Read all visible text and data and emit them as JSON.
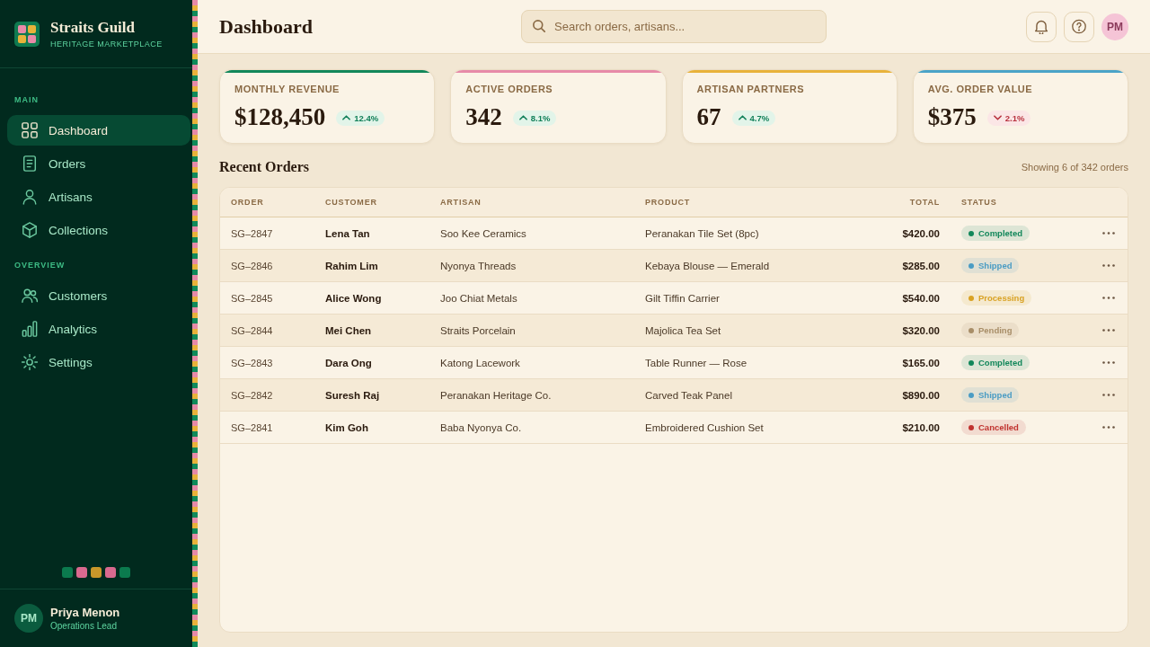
{
  "sidebar": {
    "brand": {
      "name": "Straits Guild",
      "tagline": "HERITAGE MARKETPLACE"
    },
    "sections": [
      {
        "label": "MAIN",
        "items": [
          {
            "label": "Dashboard",
            "selected": true
          },
          {
            "label": "Orders",
            "selected": false
          },
          {
            "label": "Artisans",
            "selected": false
          },
          {
            "label": "Collections",
            "selected": false
          }
        ]
      },
      {
        "label": "OVERVIEW",
        "items": [
          {
            "label": "Customers",
            "selected": false
          },
          {
            "label": "Analytics",
            "selected": false
          },
          {
            "label": "Settings",
            "selected": false
          }
        ]
      }
    ],
    "swatches": [
      {
        "color": "#0b7a4e"
      },
      {
        "color": "#d9698f"
      },
      {
        "color": "#c9972a"
      },
      {
        "color": "#d9698f"
      },
      {
        "color": "#0b7a4e"
      }
    ],
    "user": {
      "initials": "PM",
      "name": "Priya Menon",
      "role": "Operations Lead"
    }
  },
  "header": {
    "title": "Dashboard",
    "search": {
      "placeholder": "Search orders, artisans..."
    },
    "avatar": {
      "initials": "PM"
    }
  },
  "stats": [
    {
      "label": "MONTHLY REVENUE",
      "value": "$128,450",
      "change": "12.4%",
      "rising": true,
      "color": "#12875a"
    },
    {
      "label": "ACTIVE ORDERS",
      "value": "342",
      "change": "8.1%",
      "rising": true,
      "color": "#e68aa8"
    },
    {
      "label": "ARTISAN PARTNERS",
      "value": "67",
      "change": "4.7%",
      "rising": true,
      "color": "#e8b23a"
    },
    {
      "label": "AVG. ORDER VALUE",
      "value": "$375",
      "change": "2.1%",
      "rising": false,
      "color": "#4aa3c8"
    }
  ],
  "orders": {
    "title": "Recent Orders",
    "summary": "Showing 6 of 342 orders",
    "columns": [
      "ORDER",
      "CUSTOMER",
      "ARTISAN",
      "PRODUCT",
      "TOTAL",
      "STATUS"
    ],
    "rows": [
      {
        "order": "SG–2847",
        "customer": "Lena Tan",
        "artisan": "Soo Kee Ceramics",
        "product": "Peranakan Tile Set (8pc)",
        "total": "$420.00",
        "status": {
          "text": "Completed",
          "color": "#12875a"
        }
      },
      {
        "order": "SG–2846",
        "customer": "Rahim Lim",
        "artisan": "Nyonya Threads",
        "product": "Kebaya Blouse — Emerald",
        "total": "$285.00",
        "status": {
          "text": "Shipped",
          "color": "#4a9cc4"
        }
      },
      {
        "order": "SG–2845",
        "customer": "Alice Wong",
        "artisan": "Joo Chiat Metals",
        "product": "Gilt Tiffin Carrier",
        "total": "$540.00",
        "status": {
          "text": "Processing",
          "color": "#d9a224"
        }
      },
      {
        "order": "SG–2844",
        "customer": "Mei Chen",
        "artisan": "Straits Porcelain",
        "product": "Majolica Tea Set",
        "total": "$320.00",
        "status": {
          "text": "Pending",
          "color": "#a88e68"
        }
      },
      {
        "order": "SG–2843",
        "customer": "Dara Ong",
        "artisan": "Katong Lacework",
        "product": "Table Runner — Rose",
        "total": "$165.00",
        "status": {
          "text": "Completed",
          "color": "#12875a"
        }
      },
      {
        "order": "SG–2842",
        "customer": "Suresh Raj",
        "artisan": "Peranakan Heritage Co.",
        "product": "Carved Teak Panel",
        "total": "$890.00",
        "status": {
          "text": "Shipped",
          "color": "#4a9cc4"
        }
      },
      {
        "order": "SG–2841",
        "customer": "Kim Goh",
        "artisan": "Baba Nyonya Co.",
        "product": "Embroidered Cushion Set",
        "total": "$210.00",
        "status": {
          "text": "Cancelled",
          "color": "#c0322f"
        }
      }
    ]
  }
}
